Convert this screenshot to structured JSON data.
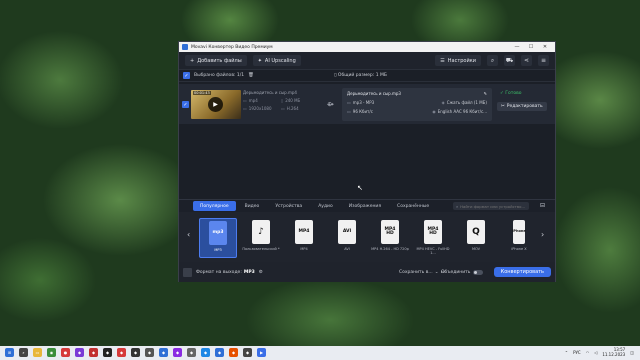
{
  "window": {
    "title": "Movavi Конвертер Видео Премиум",
    "controls": [
      "—",
      "☐",
      "✕"
    ]
  },
  "toolbar": {
    "add_files": "Добавить файлы",
    "ai_upscaling": "AI Upscaling",
    "settings": "Настройки"
  },
  "filebar": {
    "selected": "Выбрано файлов: 1/1",
    "total_size": "Общий размер: 1 МБ"
  },
  "file": {
    "duration": "00:01:43",
    "source_name": "Дерьмодитесь и сыр.mp4",
    "source": {
      "format": "mp4",
      "size": "240 МБ",
      "resolution": "1920x1080",
      "codec": "H.264"
    },
    "target_name": "Дерьмодитесь и сыр.mp3",
    "target": {
      "format": "mp3 - MP3",
      "compress": "Сжать файл (1 МБ)",
      "bitrate": "96 Кбит/с",
      "audio": "English AAC 96 Кбит/с..."
    },
    "status": "Готово",
    "edit": "Редактировать"
  },
  "format_panel": {
    "tabs": [
      "Популярное",
      "Видео",
      "Устройства",
      "Аудио",
      "Изображения",
      "Сохранённые"
    ],
    "active_tab": 0,
    "search_placeholder": "Найти формат или устройство...",
    "formats": [
      {
        "icon": "mp3",
        "label": "MP3"
      },
      {
        "icon": "♪",
        "label": "Пользовательский *"
      },
      {
        "icon": "MP4",
        "label": "MP4"
      },
      {
        "icon": "AVI",
        "label": "AVI"
      },
      {
        "icon": "MP4 HD",
        "label": "MP4 H.264 - HD 720p"
      },
      {
        "icon": "MP4 HD",
        "label": "MP4 HEVC - FullHD 1..."
      },
      {
        "icon": "Q",
        "label": "MOV"
      },
      {
        "icon": "iPhone",
        "label": "iPhone X"
      }
    ]
  },
  "bottombar": {
    "output_label": "Формат на выходе:",
    "output_value": "MP3",
    "save_to": "Сохранить в...",
    "merge": "Объединить",
    "convert": "Конвертировать"
  },
  "taskbar": {
    "lang": "РУС",
    "time": "13:57",
    "date": "11.12.2023"
  },
  "colors": {
    "accent": "#3a6ee8",
    "ready_green": "#3cc46b"
  }
}
